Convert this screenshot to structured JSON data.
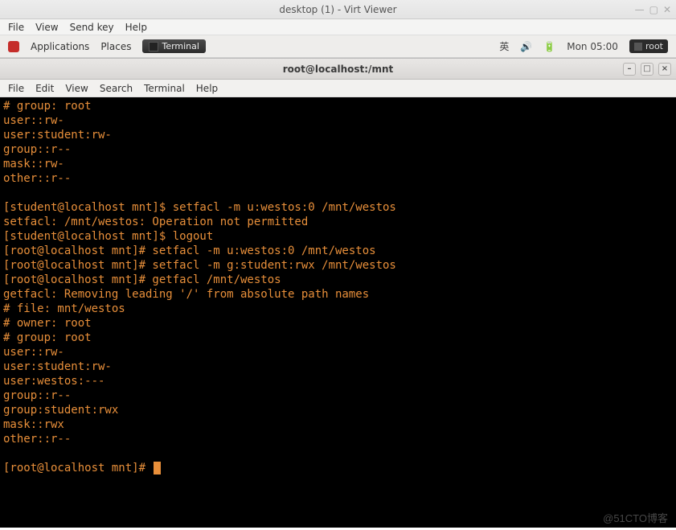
{
  "virt": {
    "title": "desktop (1) - Virt Viewer",
    "menu": [
      "File",
      "View",
      "Send key",
      "Help"
    ]
  },
  "gnome": {
    "left": [
      "Applications",
      "Places"
    ],
    "task": "Terminal",
    "ime": "英",
    "clock": "Mon 05:00",
    "user": "root"
  },
  "term": {
    "title": "root@localhost:/mnt",
    "menu": [
      "File",
      "Edit",
      "View",
      "Search",
      "Terminal",
      "Help"
    ]
  },
  "terminal_lines": [
    "# group: root",
    "user::rw-",
    "user:student:rw-",
    "group::r--",
    "mask::rw-",
    "other::r--",
    "",
    "[student@localhost mnt]$ setfacl -m u:westos:0 /mnt/westos",
    "setfacl: /mnt/westos: Operation not permitted",
    "[student@localhost mnt]$ logout",
    "[root@localhost mnt]# setfacl -m u:westos:0 /mnt/westos",
    "[root@localhost mnt]# setfacl -m g:student:rwx /mnt/westos",
    "[root@localhost mnt]# getfacl /mnt/westos",
    "getfacl: Removing leading '/' from absolute path names",
    "# file: mnt/westos",
    "# owner: root",
    "# group: root",
    "user::rw-",
    "user:student:rw-",
    "user:westos:---",
    "group::r--",
    "group:student:rwx",
    "mask::rwx",
    "other::r--",
    "",
    "[root@localhost mnt]# "
  ],
  "watermark": "@51CTO博客"
}
